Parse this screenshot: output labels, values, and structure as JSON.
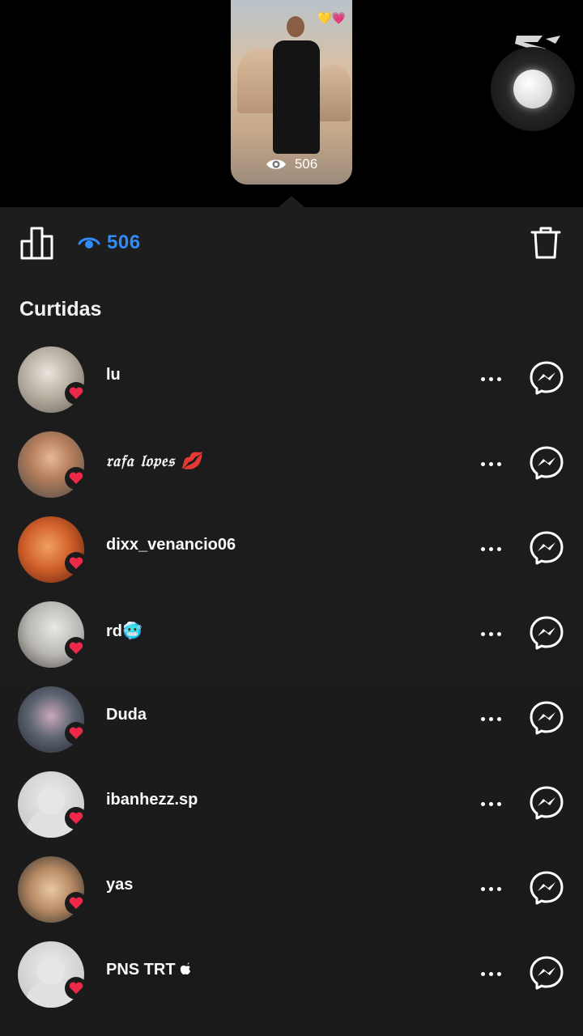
{
  "story": {
    "view_count": "506",
    "sticker": "💛💗"
  },
  "toolbar": {
    "views": "506"
  },
  "section": {
    "title": "Curtidas"
  },
  "likes": [
    {
      "username": "lu",
      "avatar": "photo-1",
      "avatar_color": "#8f8478"
    },
    {
      "username": "𝔯𝔞𝔣𝔞 𝔩𝔬𝔭𝔢𝔰 💋",
      "avatar": "photo-2",
      "avatar_color": "#7d6350"
    },
    {
      "username": "dixx_venancio06",
      "avatar": "photo-3",
      "avatar_color": "#c8521e"
    },
    {
      "username": "rd🥶",
      "avatar": "photo-4",
      "avatar_color": "#9a9a98"
    },
    {
      "username": "Duda",
      "avatar": "photo-5",
      "avatar_color": "#59616e"
    },
    {
      "username": "ibanhezz.sp",
      "avatar": "default-avatar",
      "avatar_color": "#d4d4d4"
    },
    {
      "username": "yas",
      "avatar": "photo-6",
      "avatar_color": "#a07b5a"
    },
    {
      "username": "PNS TRT ",
      "avatar": "default-avatar",
      "avatar_color": "#d4d4d4"
    }
  ],
  "colors": {
    "accent": "#2f8cf7",
    "heart": "#ed2848",
    "sheet_bg": "#1d1d1d"
  }
}
